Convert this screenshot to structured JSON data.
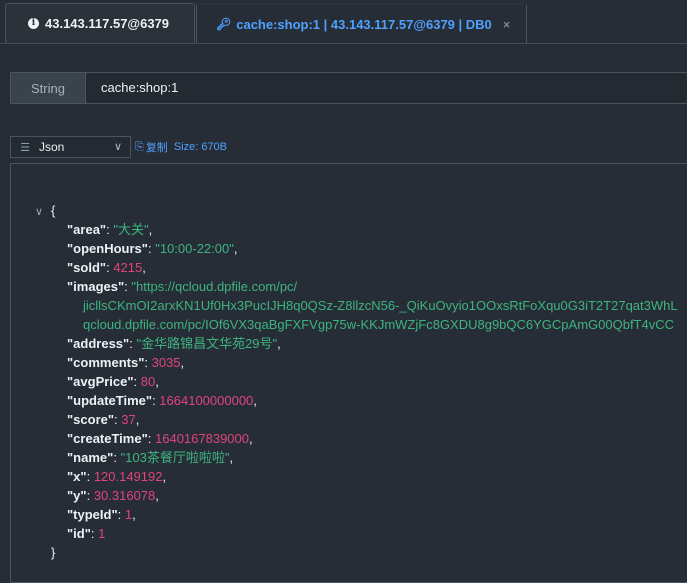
{
  "tabs": [
    {
      "label": "43.143.117.57@6379",
      "icon": "info-icon",
      "active": false
    },
    {
      "label": "cache:shop:1 | 43.143.117.57@6379 | DB0",
      "icon": "key-icon",
      "active": true,
      "close": "×"
    }
  ],
  "key": {
    "type": "String",
    "name": "cache:shop:1"
  },
  "toolbar": {
    "format": "Json",
    "copy_label": "复制",
    "size_label": "Size: 670B"
  },
  "json": {
    "open": "{",
    "close": "}",
    "lines": [
      {
        "key": "area",
        "value": "大关",
        "kind": "string"
      },
      {
        "key": "openHours",
        "value": "10:00-22:00",
        "kind": "string"
      },
      {
        "key": "sold",
        "value": "4215",
        "kind": "number"
      },
      {
        "key": "images",
        "value": "https://qcloud.dpfile.com/pc/",
        "kind": "string_start"
      },
      {
        "cont": "jicllsCKmOI2arxKN1Uf0Hx3PucIJH8q0QSz-Z8llzcN56-_QiKuOvyio1OOxsRtFoXqu0G3iT2T27qat3WhL"
      },
      {
        "cont": "qcloud.dpfile.com/pc/IOf6VX3qaBgFXFVgp75w-KKJmWZjFc8GXDU8g9bQC6YGCpAmG00QbfT4vCC"
      },
      {
        "key": "address",
        "value": "金华路锦昌文华苑29号",
        "kind": "string"
      },
      {
        "key": "comments",
        "value": "3035",
        "kind": "number"
      },
      {
        "key": "avgPrice",
        "value": "80",
        "kind": "number"
      },
      {
        "key": "updateTime",
        "value": "1664100000000",
        "kind": "number"
      },
      {
        "key": "score",
        "value": "37",
        "kind": "number"
      },
      {
        "key": "createTime",
        "value": "1640167839000",
        "kind": "number"
      },
      {
        "key": "name",
        "value": "103茶餐厅啦啦啦",
        "kind": "string"
      },
      {
        "key": "x",
        "value": "120.149192",
        "kind": "number"
      },
      {
        "key": "y",
        "value": "30.316078",
        "kind": "number"
      },
      {
        "key": "typeId",
        "value": "1",
        "kind": "number"
      },
      {
        "key": "id",
        "value": "1",
        "kind": "number",
        "last": true
      }
    ]
  }
}
